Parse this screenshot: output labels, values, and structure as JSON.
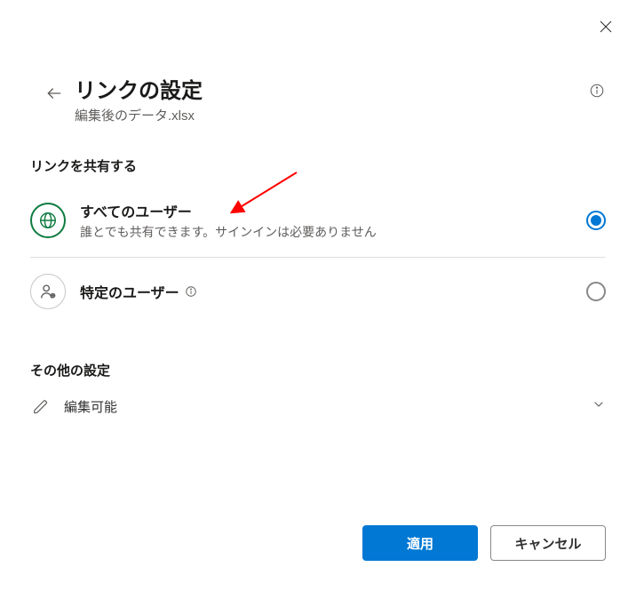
{
  "header": {
    "title": "リンクの設定",
    "subtitle": "編集後のデータ.xlsx"
  },
  "share_section": {
    "label": "リンクを共有する",
    "options": [
      {
        "title": "すべてのユーザー",
        "desc": "誰とでも共有できます。サインインは必要ありません",
        "selected": true
      },
      {
        "title": "特定のユーザー",
        "desc": "",
        "selected": false
      }
    ]
  },
  "other_section": {
    "label": "その他の設定",
    "permission": "編集可能"
  },
  "footer": {
    "apply": "適用",
    "cancel": "キャンセル"
  }
}
